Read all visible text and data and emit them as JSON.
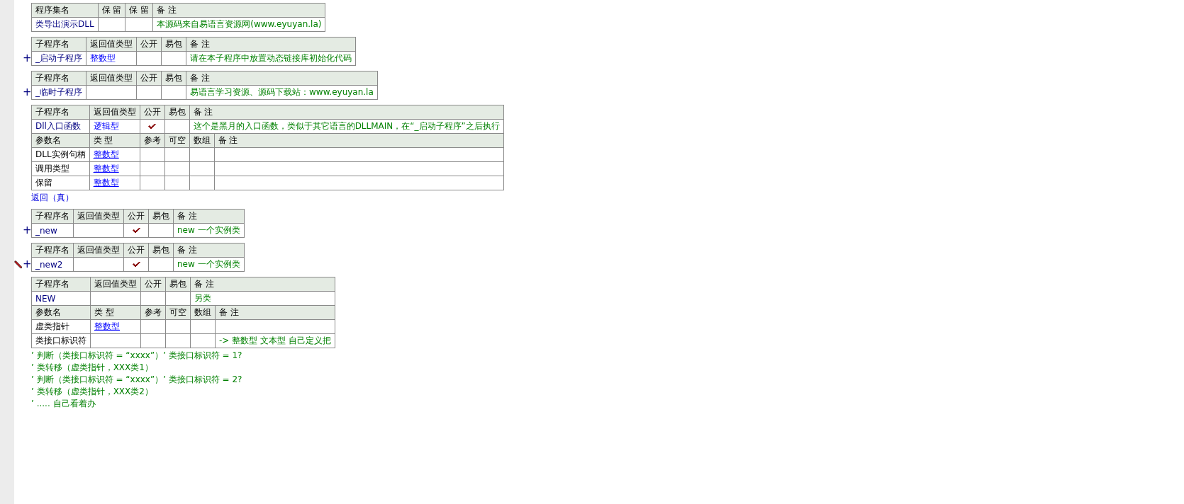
{
  "blocks": [
    {
      "kind": "assembly",
      "columns": [
        "程序集名",
        "保 留",
        "保 留",
        "备 注"
      ],
      "row": {
        "name": "类导出演示DLL",
        "remark": "本源码来自易语言资源网(www.eyuyan.la)"
      }
    },
    {
      "kind": "sub",
      "toggle": "+",
      "editing": false,
      "columns": [
        "子程序名",
        "返回值类型",
        "公开",
        "易包",
        "备 注"
      ],
      "row": {
        "name": "_启动子程序",
        "return_type": "整数型",
        "public": false,
        "remark": "请在本子程序中放置动态链接库初始化代码"
      }
    },
    {
      "kind": "sub",
      "toggle": "+",
      "editing": false,
      "columns": [
        "子程序名",
        "返回值类型",
        "公开",
        "易包",
        "备 注"
      ],
      "row": {
        "name": "_临时子程序",
        "public": false,
        "remark": "易语言学习资源、源码下载站：www.eyuyan.la"
      }
    },
    {
      "kind": "sub",
      "editing": false,
      "columns": [
        "子程序名",
        "返回值类型",
        "公开",
        "易包",
        "备 注"
      ],
      "row": {
        "name": "Dll入口函数",
        "return_type": "逻辑型",
        "public": true,
        "remark": "这个是黑月的入口函数，类似于其它语言的DLLMAIN，在“_启动子程序”之后执行"
      },
      "param_columns": [
        "参数名",
        "类 型",
        "参考",
        "可空",
        "数组",
        "备 注"
      ],
      "params": [
        {
          "name": "DLL实例句柄",
          "type": "整数型"
        },
        {
          "name": "调用类型",
          "type": "整数型"
        },
        {
          "name": "保留",
          "type": "整数型"
        }
      ],
      "lines": [
        {
          "kind": "code",
          "text": "返回（真）"
        }
      ]
    },
    {
      "kind": "sub",
      "toggle": "+",
      "editing": false,
      "columns": [
        "子程序名",
        "返回值类型",
        "公开",
        "易包",
        "备 注"
      ],
      "row": {
        "name": "_new",
        "public": true,
        "remark": "new 一个实例类"
      }
    },
    {
      "kind": "sub",
      "toggle": "+",
      "editing": true,
      "columns": [
        "子程序名",
        "返回值类型",
        "公开",
        "易包",
        "备 注"
      ],
      "row": {
        "name": "_new2",
        "public": true,
        "remark": "new 一个实例类"
      }
    },
    {
      "kind": "sub",
      "editing": false,
      "columns": [
        "子程序名",
        "返回值类型",
        "公开",
        "易包",
        "备 注"
      ],
      "row": {
        "name": "NEW",
        "public": false,
        "remark": "另类"
      },
      "param_columns": [
        "参数名",
        "类 型",
        "参考",
        "可空",
        "数组",
        "备 注"
      ],
      "params": [
        {
          "name": "虚类指针",
          "type": "整数型"
        },
        {
          "name": "类接口标识符",
          "remark": "-> 整数型 文本型 自己定义把"
        }
      ],
      "lines": [
        {
          "kind": "comment",
          "text": "’ 判断（类接口标识符 = “xxxx”）’ 类接口标识符 = 1?"
        },
        {
          "kind": "comment",
          "text": "’ 类转移（虚类指针，XXX类1）"
        },
        {
          "kind": "comment",
          "text": "’ 判断（类接口标识符 = “xxxx”）’ 类接口标识符 = 2?"
        },
        {
          "kind": "comment",
          "text": "’ 类转移（虚类指针，XXX类2）"
        },
        {
          "kind": "comment",
          "text": "’ ..... 自己看着办"
        }
      ]
    }
  ]
}
